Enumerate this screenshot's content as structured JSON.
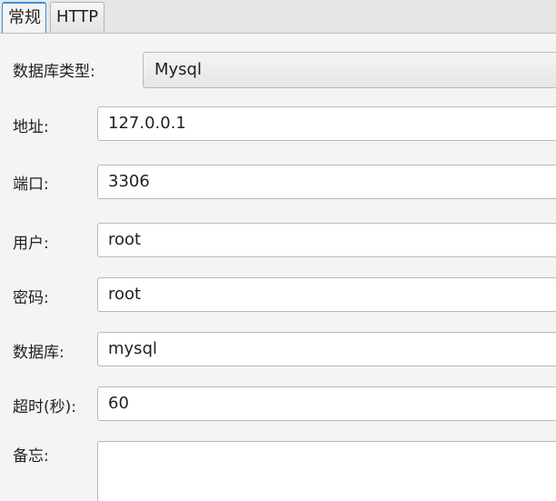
{
  "tabs": [
    {
      "label": "常规",
      "active": true
    },
    {
      "label": "HTTP",
      "active": false
    }
  ],
  "form": {
    "db_type": {
      "label": "数据库类型:",
      "value": "Mysql"
    },
    "host": {
      "label": "地址:",
      "value": "127.0.0.1"
    },
    "port": {
      "label": "端口:",
      "value": "3306"
    },
    "user": {
      "label": "用户:",
      "value": "root"
    },
    "password": {
      "label": "密码:",
      "value": "root"
    },
    "database": {
      "label": "数据库:",
      "value": "mysql"
    },
    "timeout": {
      "label": "超时(秒):",
      "value": "60"
    },
    "remark": {
      "label": "备忘:",
      "value": ""
    }
  },
  "colors": {
    "active_tab_accent": "#3c8fd6",
    "field_border": "#b9b9b9"
  }
}
